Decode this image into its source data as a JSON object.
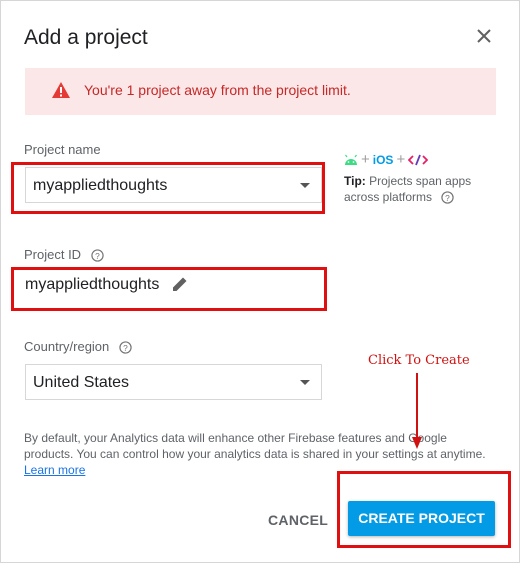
{
  "dialog": {
    "title": "Add a project",
    "close_icon": "close-icon"
  },
  "warning": {
    "icon": "warning-triangle-icon",
    "text": "You're 1 project away from the project limit.",
    "color": "#c62828",
    "background": "#fbe7e7"
  },
  "project_name": {
    "label": "Project name",
    "value": "myappliedthoughts"
  },
  "project_id": {
    "label": "Project ID",
    "value": "myappliedthoughts",
    "edit_icon": "pencil-icon"
  },
  "tip": {
    "ios": "iOS",
    "bold": "Tip:",
    "text": " Projects span apps across platforms"
  },
  "country": {
    "label": "Country/region",
    "value": "United States"
  },
  "analytics": {
    "text": "By default, your Analytics data will enhance other Firebase features and Google products. You can control how your analytics data is shared in your settings at anytime.",
    "learn_more": "Learn more"
  },
  "actions": {
    "cancel": "CANCEL",
    "create": "CREATE PROJECT",
    "accent": "#039be5"
  },
  "annotation": {
    "text": "Click To Create",
    "color": "#d11111"
  }
}
